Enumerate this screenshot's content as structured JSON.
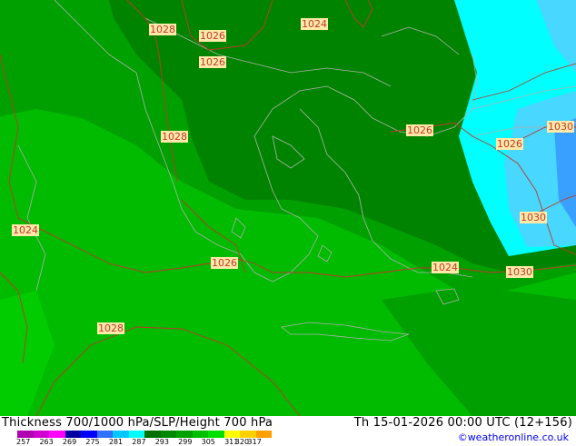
{
  "map": {
    "isobar_labels": [
      "1028",
      "1026",
      "1024",
      "1026",
      "1028",
      "1026",
      "1026",
      "1030",
      "1030",
      "1030",
      "1024",
      "1026",
      "1024",
      "1028",
      "1026"
    ],
    "colors": {
      "thickness_dark": "#008400",
      "thickness_mid": "#00a000",
      "thickness_light": "#00bb00",
      "thickness_bright": "#00cc00",
      "cyan": "#00ffff",
      "light_blue": "#47d7ff",
      "blue": "#3aa0ff",
      "isobar": "#c0392b",
      "coast": "#b0b0b0",
      "label_bg": "#ffe9a8"
    }
  },
  "footer": {
    "title": "Thickness 700/1000 hPa/SLP/Height 700 hPa",
    "datetime": "Th 15-01-2026 00:00 UTC (12+156)",
    "credit": "©weatheronline.co.uk",
    "colorbar_ticks": [
      "257",
      "263",
      "269",
      "275",
      "281",
      "287",
      "293",
      "299",
      "305",
      "311",
      "317",
      "320"
    ],
    "colorbar_colors": [
      "#b000b0",
      "#d000d0",
      "#ff00ff",
      "#0000a0",
      "#0000ff",
      "#3070ff",
      "#00c8ff",
      "#00ffff",
      "#007000",
      "#008800",
      "#00a000",
      "#00c000",
      "#00e000",
      "#ffff00",
      "#ffd000",
      "#ffa000"
    ]
  }
}
